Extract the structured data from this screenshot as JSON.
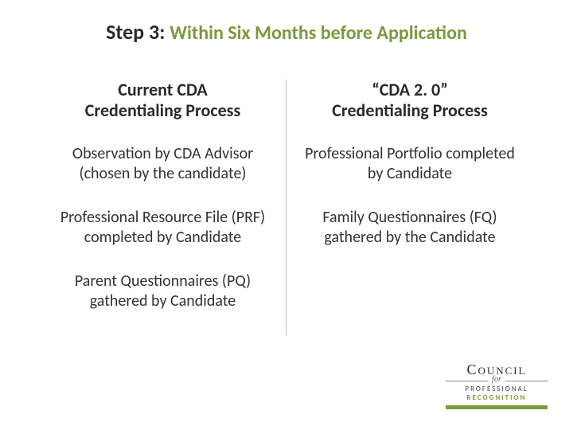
{
  "title": {
    "step": "Step 3:",
    "subtitle": "Within Six Months before Application"
  },
  "left": {
    "heading_l1": "Current CDA",
    "heading_l2": "Credentialing Process",
    "items": [
      "Observation by CDA Advisor (chosen by the candidate)",
      "Professional Resource File (PRF) completed by Candidate",
      "Parent Questionnaires (PQ) gathered by Candidate"
    ]
  },
  "right": {
    "heading_l1": "“CDA 2. 0”",
    "heading_l2": "Credentialing Process",
    "items": [
      "Professional Portfolio completed by Candidate",
      "Family Questionnaires (FQ) gathered by the Candidate"
    ]
  },
  "logo": {
    "council": "Council",
    "for": "for",
    "line1": "PROFESSIONAL",
    "line2": "RECOGNITION"
  }
}
